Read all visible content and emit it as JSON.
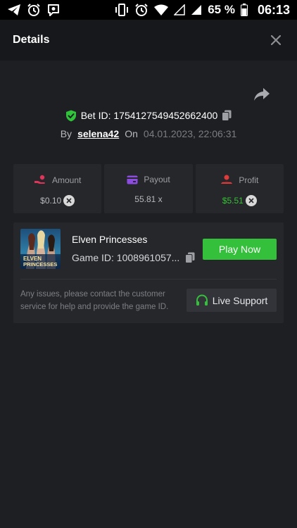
{
  "status_bar": {
    "battery_percent": "65 %",
    "time": "06:13",
    "left_icons": [
      "telegram-icon",
      "alarm-icon",
      "viber-icon"
    ],
    "right_icons": [
      "vibrate-icon",
      "alarm-icon",
      "wifi-icon",
      "signal-icon",
      "signal-icon",
      "battery-icon"
    ]
  },
  "header": {
    "title": "Details"
  },
  "bet": {
    "id_text": "Bet ID: 1754127549452662400",
    "by_label": "By",
    "username": "selena42",
    "on_label": "On",
    "date": "04.01.2023, 22:06:31"
  },
  "stats": [
    {
      "label": "Amount",
      "value": "$0.10",
      "has_x": true,
      "icon": "hand-coins-icon",
      "icon_color": "#e0345a"
    },
    {
      "label": "Payout",
      "value": "55.81 x",
      "has_x": false,
      "icon": "card-icon",
      "icon_color": "#8c4ce0"
    },
    {
      "label": "Profit",
      "value": "$5.51",
      "has_x": true,
      "icon": "user-profit-icon",
      "icon_color": "#e03a3a"
    }
  ],
  "game": {
    "name": "Elven Princesses",
    "id_text": "Game ID: 1008961057...",
    "thumb_text_line1": "ELVEN",
    "thumb_text_line2": "PRINCESSES",
    "play_label": "Play Now"
  },
  "help": {
    "text": "Any issues, please contact the customer service for help and provide the game ID.",
    "support_label": "Live Support"
  },
  "colors": {
    "accent_green": "#34c03a",
    "profit_green": "#35c235",
    "background": "#1e1f23",
    "card": "#26272b"
  }
}
